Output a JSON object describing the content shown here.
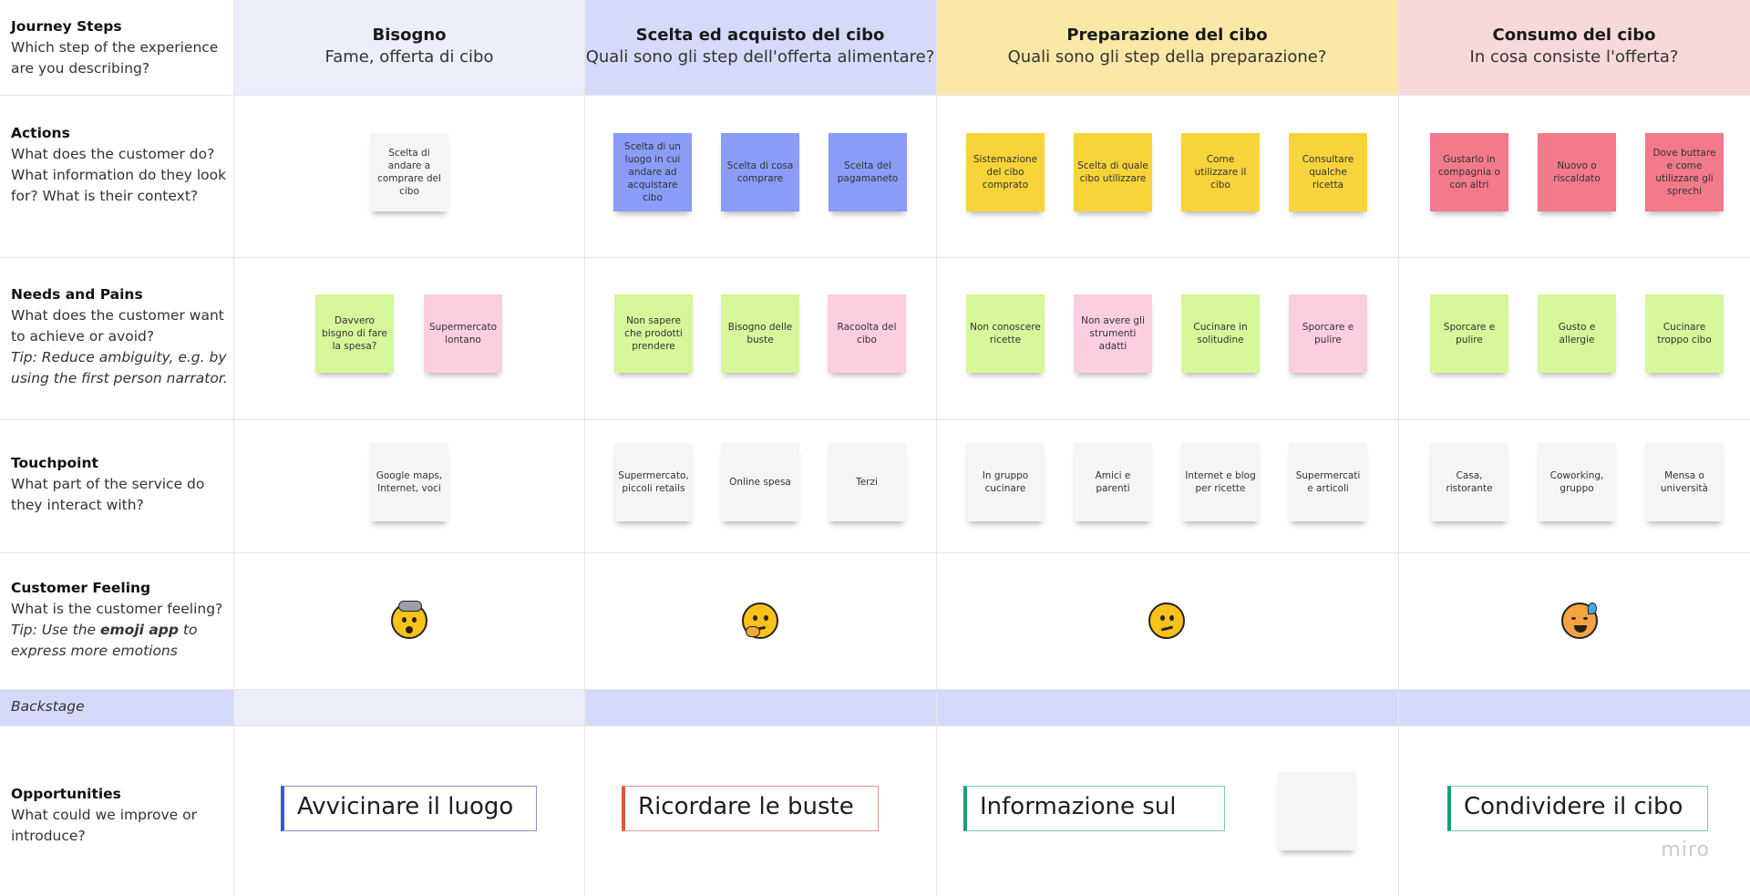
{
  "rows": {
    "journey": {
      "title": "Journey Steps",
      "text": "Which step of the experience are you describing?"
    },
    "actions": {
      "title": "Actions",
      "text": "What does the customer do? What information do they look for? What is their context?"
    },
    "needs": {
      "title": "Needs and Pains",
      "text": "What does the customer want to achieve or avoid?",
      "tip": "Tip: Reduce ambiguity, e.g. by using the first person narrator."
    },
    "touchpoint": {
      "title": "Touchpoint",
      "text": "What part of the service do they interact with?"
    },
    "feeling": {
      "title": "Customer Feeling",
      "text": "What is the customer feeling?",
      "tip_pre": "Tip: Use the ",
      "tip_bold": "emoji app",
      "tip_post": " to express more emotions"
    },
    "backstage": {
      "title": "Backstage"
    },
    "opportunities": {
      "title": "Opportunities",
      "text": "What could we improve or introduce?"
    }
  },
  "phases": [
    {
      "title": "Bisogno",
      "subtitle": "Fame, offerta di cibo"
    },
    {
      "title": "Scelta ed acquisto del cibo",
      "subtitle": "Quali sono gli step dell'offerta alimentare?"
    },
    {
      "title": "Preparazione del cibo",
      "subtitle": "Quali sono gli step della preparazione?"
    },
    {
      "title": "Consumo del cibo",
      "subtitle": "In cosa consiste l'offerta?"
    }
  ],
  "actions": [
    "Scelta di andare a comprare del cibo",
    "Scelta di un luogo in cui andare ad acquistare cibo",
    "Scelta di cosa comprare",
    "Scelta del pagamaneto",
    "Sistemazione del cibo comprato",
    "Scelta di quale cibo utilizzare",
    "Come utilizzare il cibo",
    "Consultare qualche ricetta",
    "Gustarlo in compagnia o con altri",
    "Nuovo o riscaldato",
    "Dove buttare e come utilizzare gli sprechi"
  ],
  "needs": [
    "Davvero bisgno di fare la spesa?",
    "Supermercato lontano",
    "Non sapere che prodotti prendere",
    "Bisogno delle buste",
    "Racoolta del cibo",
    "Non conoscere ricette",
    "Non avere gli strumenti adatti",
    "Cucinare in solitudine",
    "Sporcare e pulire",
    "Sporcare e pulire",
    "Gusto e allergie",
    "Cucinare troppo cibo"
  ],
  "touchpoints": [
    "Google maps, Internet, voci",
    "Supermercato, piccoli retails",
    "Online spesa",
    "Terzi",
    "In gruppo cucinare",
    "Amici e parenti",
    "Internet e blog per ricette",
    "Supermercati e articoli",
    "Casa, ristorante",
    "Coworking, gruppo",
    "Mensa o università"
  ],
  "feelings": [
    "exploding-head-icon",
    "thinking-face-icon",
    "confused-face-icon",
    "hot-face-icon"
  ],
  "opportunities": [
    {
      "text": "Avvicinare il luogo",
      "color": "#3b55d9"
    },
    {
      "text": "Ricordare le buste",
      "color": "#e0583a"
    },
    {
      "text": "Informazione sul",
      "color": "#1a9e79"
    },
    {
      "text": "Condividere il cibo",
      "color": "#1a9e79"
    }
  ],
  "colors": {
    "phase1": "#eceefb",
    "phase2": "#d5dafb",
    "phase3": "#fbe8a6",
    "phase4": "#f8d9da",
    "blue_sticky": "#8a9bf8",
    "yellow_sticky": "#f7d43a",
    "red_sticky": "#f27a8a",
    "green_sticky": "#d6f79a",
    "pink_sticky": "#fdcde0",
    "white_sticky": "#f4f5f6"
  },
  "watermark": "miro"
}
